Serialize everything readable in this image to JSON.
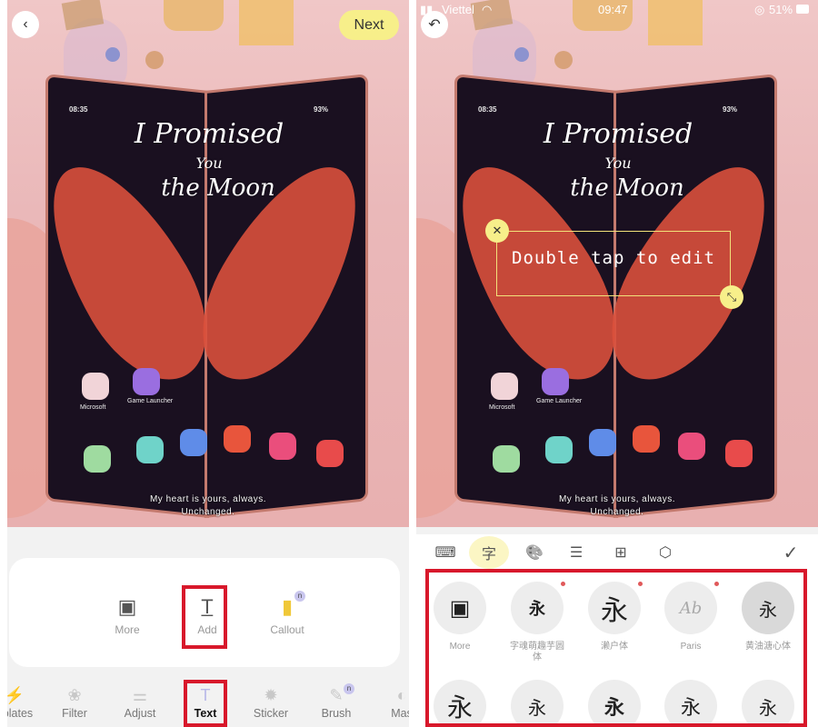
{
  "left_screen": {
    "back_icon": "chevron-left-icon",
    "next_label": "Next",
    "phone_status": {
      "time": "08:35",
      "battery": "93%"
    },
    "wallpaper_text": {
      "line1": "I Promised",
      "line2": "You",
      "line3": "the Moon"
    },
    "apps": [
      {
        "label": "Microsoft"
      },
      {
        "label": "Game Launcher"
      }
    ],
    "caption": {
      "line1": "My heart is yours, always.",
      "line2": "Unchanged."
    },
    "text_submenu": [
      {
        "label": "More",
        "icon": "store-icon"
      },
      {
        "label": "Add",
        "icon": "add-text-icon",
        "highlighted": true
      },
      {
        "label": "Callout",
        "icon": "callout-icon",
        "badge": "n"
      }
    ],
    "bottom_tabs": [
      {
        "label": "Templates",
        "display": "nplates",
        "icon": "templates-icon"
      },
      {
        "label": "Filter",
        "icon": "filter-icon"
      },
      {
        "label": "Adjust",
        "icon": "adjust-icon"
      },
      {
        "label": "Text",
        "icon": "text-icon",
        "active": true
      },
      {
        "label": "Sticker",
        "icon": "sticker-icon"
      },
      {
        "label": "Brush",
        "icon": "brush-icon",
        "badge": "n"
      },
      {
        "label": "Mask",
        "display": "Mas",
        "icon": "mask-icon"
      }
    ]
  },
  "right_screen": {
    "status_bar": {
      "carrier": "Viettel",
      "time": "09:47",
      "battery": "51%"
    },
    "undo_icon": "undo-icon",
    "phone_status": {
      "time": "08:35",
      "battery": "93%"
    },
    "wallpaper_text": {
      "line1": "I Promised",
      "line2": "You",
      "line3": "the Moon"
    },
    "apps": [
      {
        "label": "Microsoft"
      },
      {
        "label": "Game Launcher"
      }
    ],
    "text_box": {
      "placeholder": "Double tap to edit"
    },
    "caption": {
      "line1": "My heart is yours, always.",
      "line2": "Unchanged."
    },
    "toolbar": [
      {
        "name": "keyboard",
        "icon": "keyboard-icon",
        "glyph": "⌨"
      },
      {
        "name": "font",
        "icon": "font-icon",
        "glyph": "字",
        "active": true
      },
      {
        "name": "color",
        "icon": "palette-icon",
        "glyph": "🎨"
      },
      {
        "name": "align",
        "icon": "align-icon",
        "glyph": "☰"
      },
      {
        "name": "add",
        "icon": "add-box-icon",
        "glyph": "⊞"
      },
      {
        "name": "style",
        "icon": "hexagon-icon",
        "glyph": "⬡"
      }
    ],
    "confirm_icon": "checkmark-icon",
    "fonts_row1": [
      {
        "name": "More",
        "preview": "▣",
        "new": false
      },
      {
        "name": "字魂萌趣芋圆体",
        "preview": "永",
        "new": true
      },
      {
        "name": "濑户体",
        "preview": "永",
        "new": true
      },
      {
        "name": "Paris",
        "preview": "Ab",
        "new": true
      },
      {
        "name": "黄油溏心体",
        "preview": "永",
        "new": false,
        "selected": true
      }
    ],
    "fonts_row2": [
      {
        "preview": "永"
      },
      {
        "preview": "永"
      },
      {
        "preview": "永"
      },
      {
        "preview": "永"
      },
      {
        "preview": "永"
      }
    ]
  },
  "colors": {
    "accent_yellow": "#f7ef8a",
    "highlight_red": "#d8182b",
    "new_dot": "#e0595a"
  }
}
